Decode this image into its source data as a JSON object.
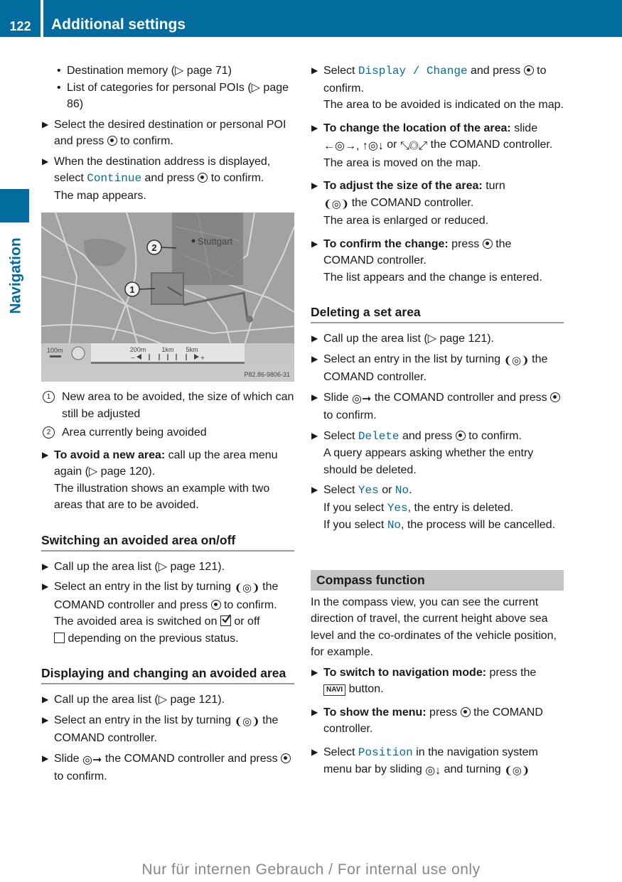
{
  "header": {
    "page_number": "122",
    "title": "Additional settings"
  },
  "side_tab": {
    "label": "Navigation"
  },
  "colors": {
    "accent": "#036c9e",
    "section_bar": "#c5c5c5"
  },
  "left": {
    "sub_bullets": [
      {
        "text": "Destination memory (▷ page 71)"
      },
      {
        "text": "List of categories for personal POIs (▷ page 86)"
      }
    ],
    "step1": {
      "pre": "Select the desired destination or personal POI and press",
      "post": "to confirm."
    },
    "step2": {
      "pre": "When the destination address is displayed, select",
      "mono": "Continue",
      "mid": "and press",
      "post": "to confirm.",
      "result": "The map appears."
    },
    "map": {
      "city_label": "Stuttgart",
      "callout_1": "1",
      "callout_2": "2",
      "scale_left": "100m",
      "scale_ticks": [
        "200m",
        "1km",
        "5km"
      ],
      "minus": "−",
      "plus": "+",
      "figure_code": "P82.86-9806-31"
    },
    "legend": [
      {
        "num": "1",
        "text": "New area to be avoided, the size of which can still be adjusted"
      },
      {
        "num": "2",
        "text": "Area currently being avoided"
      }
    ],
    "step3": {
      "bold": "To avoid a new area:",
      "text": "call up the area menu again (▷ page 120).",
      "result": "The illustration shows an example with two areas that are to be avoided."
    },
    "section1": {
      "title": "Switching an avoided area on/off",
      "step1": "Call up the area list (▷ page 121).",
      "step2_pre": "Select an entry in the list by turning",
      "step2_mid": "the COMAND controller and press",
      "step2_post": "to confirm.",
      "result_pre": "The avoided area is switched on",
      "result_mid": "or off",
      "result_post": "depending on the previous status."
    },
    "section2": {
      "title": "Displaying and changing an avoided area",
      "step1": "Call up the area list (▷ page 121).",
      "step2_pre": "Select an entry in the list by turning",
      "step2_post": "the COMAND controller.",
      "step3_pre": "Slide",
      "step3_mid": "the COMAND controller and press",
      "step3_post": "to confirm."
    }
  },
  "right": {
    "step1": {
      "pre": "Select",
      "mono": "Display / Change",
      "mid": "and press",
      "post": "to confirm.",
      "result": "The area to be avoided is indicated on the map."
    },
    "step2": {
      "bold": "To change the location of the area:",
      "pre": "slide",
      "post": "the COMAND controller.",
      "result": "The area is moved on the map."
    },
    "step3": {
      "bold": "To adjust the size of the area:",
      "pre": "turn",
      "post": "the COMAND controller.",
      "result": "The area is enlarged or reduced."
    },
    "step4": {
      "bold": "To confirm the change:",
      "pre": "press",
      "post": "the COMAND controller.",
      "result": "The list appears and the change is entered."
    },
    "section3": {
      "title": "Deleting a set area",
      "step1": "Call up the area list (▷ page 121).",
      "step2_pre": "Select an entry in the list by turning",
      "step2_post": "the COMAND controller.",
      "step3_pre": "Slide",
      "step3_mid": "the COMAND controller and press",
      "step3_post": "to confirm.",
      "step4_pre": "Select",
      "step4_mono": "Delete",
      "step4_mid": "and press",
      "step4_post": "to confirm.",
      "step4_result": "A query appears asking whether the entry should be deleted.",
      "step5_pre": "Select",
      "yes": "Yes",
      "or": "or",
      "no": "No",
      "yes_result_pre": "If you select",
      "yes_result_post": ", the entry is deleted.",
      "no_result_pre": "If you select",
      "no_result_post": ", the process will be cancelled."
    },
    "compass": {
      "title": "Compass function",
      "intro": "In the compass view, you can see the current direction of travel, the current height above sea level and the co-ordinates of the vehicle position, for example.",
      "step1_bold": "To switch to navigation mode:",
      "step1_pre": "press the",
      "navi_key": "NAVI",
      "step1_post": "button.",
      "step2_bold": "To show the menu:",
      "step2_pre": "press",
      "step2_post": "the COMAND controller.",
      "step3_pre": "Select",
      "step3_mono": "Position",
      "step3_mid": "in the navigation system menu bar by sliding",
      "step3_post": "and turning"
    }
  },
  "footer": {
    "watermark": "Nur für internen Gebrauch / For internal use only"
  }
}
